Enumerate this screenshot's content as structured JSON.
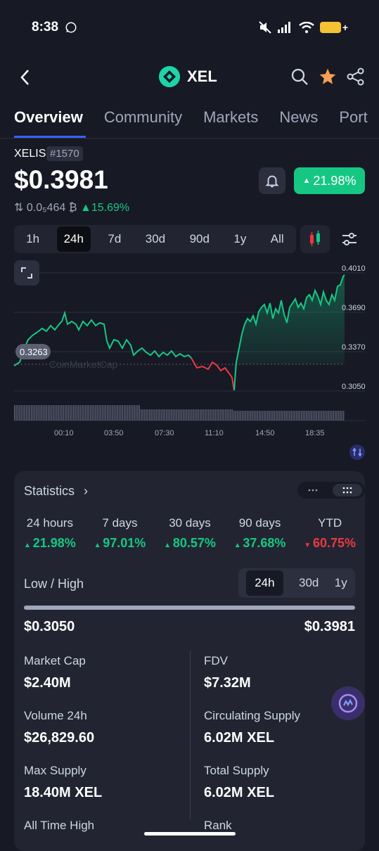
{
  "status_bar": {
    "time": "8:38"
  },
  "header": {
    "title": "XEL"
  },
  "tabs": [
    "Overview",
    "Community",
    "Markets",
    "News",
    "Port"
  ],
  "coin": {
    "name": "XELIS",
    "rank": "#1570",
    "price": "$0.3981",
    "btc_price": "0.0₅464 ₿",
    "btc_change": "15.69%",
    "change_24h": "21.98%"
  },
  "timeframes": [
    "1h",
    "24h",
    "7d",
    "30d",
    "90d",
    "1y",
    "All"
  ],
  "active_timeframe": "24h",
  "chart": {
    "y_ticks": [
      "0.4010",
      "0.3690",
      "0.3370",
      "0.3050"
    ],
    "x_ticks": [
      "00:10",
      "03:50",
      "07:30",
      "11:10",
      "14:50",
      "18:35"
    ],
    "open_label": "0.3263",
    "watermark": "CoinMarketCap"
  },
  "chart_data": {
    "type": "line",
    "x": [
      "00:10",
      "03:50",
      "07:30",
      "11:10",
      "14:50",
      "18:35"
    ],
    "series": [
      {
        "values": [
          0.352,
          0.345,
          0.334,
          0.316,
          0.368,
          0.378
        ]
      }
    ],
    "ylim": [
      0.305,
      0.401
    ],
    "open_price": 0.3263,
    "colors": {
      "up": "#16c784",
      "down": "#ea3943"
    }
  },
  "statistics": {
    "title": "Statistics",
    "performance": [
      {
        "label": "24 hours",
        "value": "21.98%",
        "dir": "up"
      },
      {
        "label": "7 days",
        "value": "97.01%",
        "dir": "up"
      },
      {
        "label": "30 days",
        "value": "80.57%",
        "dir": "up"
      },
      {
        "label": "90 days",
        "value": "37.68%",
        "dir": "up"
      },
      {
        "label": "YTD",
        "value": "60.75%",
        "dir": "down"
      }
    ],
    "low_high_label": "Low / High",
    "low_high_tabs": [
      "24h",
      "30d",
      "1y"
    ],
    "low": "$0.3050",
    "high": "$0.3981",
    "metrics": [
      {
        "label": "Market Cap",
        "value": "$2.40M"
      },
      {
        "label": "FDV",
        "value": "$7.32M"
      },
      {
        "label": "Volume 24h",
        "value": "$26,829.60"
      },
      {
        "label": "Circulating Supply",
        "value": "6.02M XEL"
      },
      {
        "label": "Max Supply",
        "value": "18.40M XEL"
      },
      {
        "label": "Total Supply",
        "value": "6.02M XEL"
      },
      {
        "label": "All Time High",
        "value": ""
      },
      {
        "label": "Rank",
        "value": ""
      }
    ]
  },
  "colors": {
    "accent": "#3861fb",
    "up": "#16c784",
    "down": "#ea3943",
    "bg": "#171924",
    "card": "#222531"
  }
}
